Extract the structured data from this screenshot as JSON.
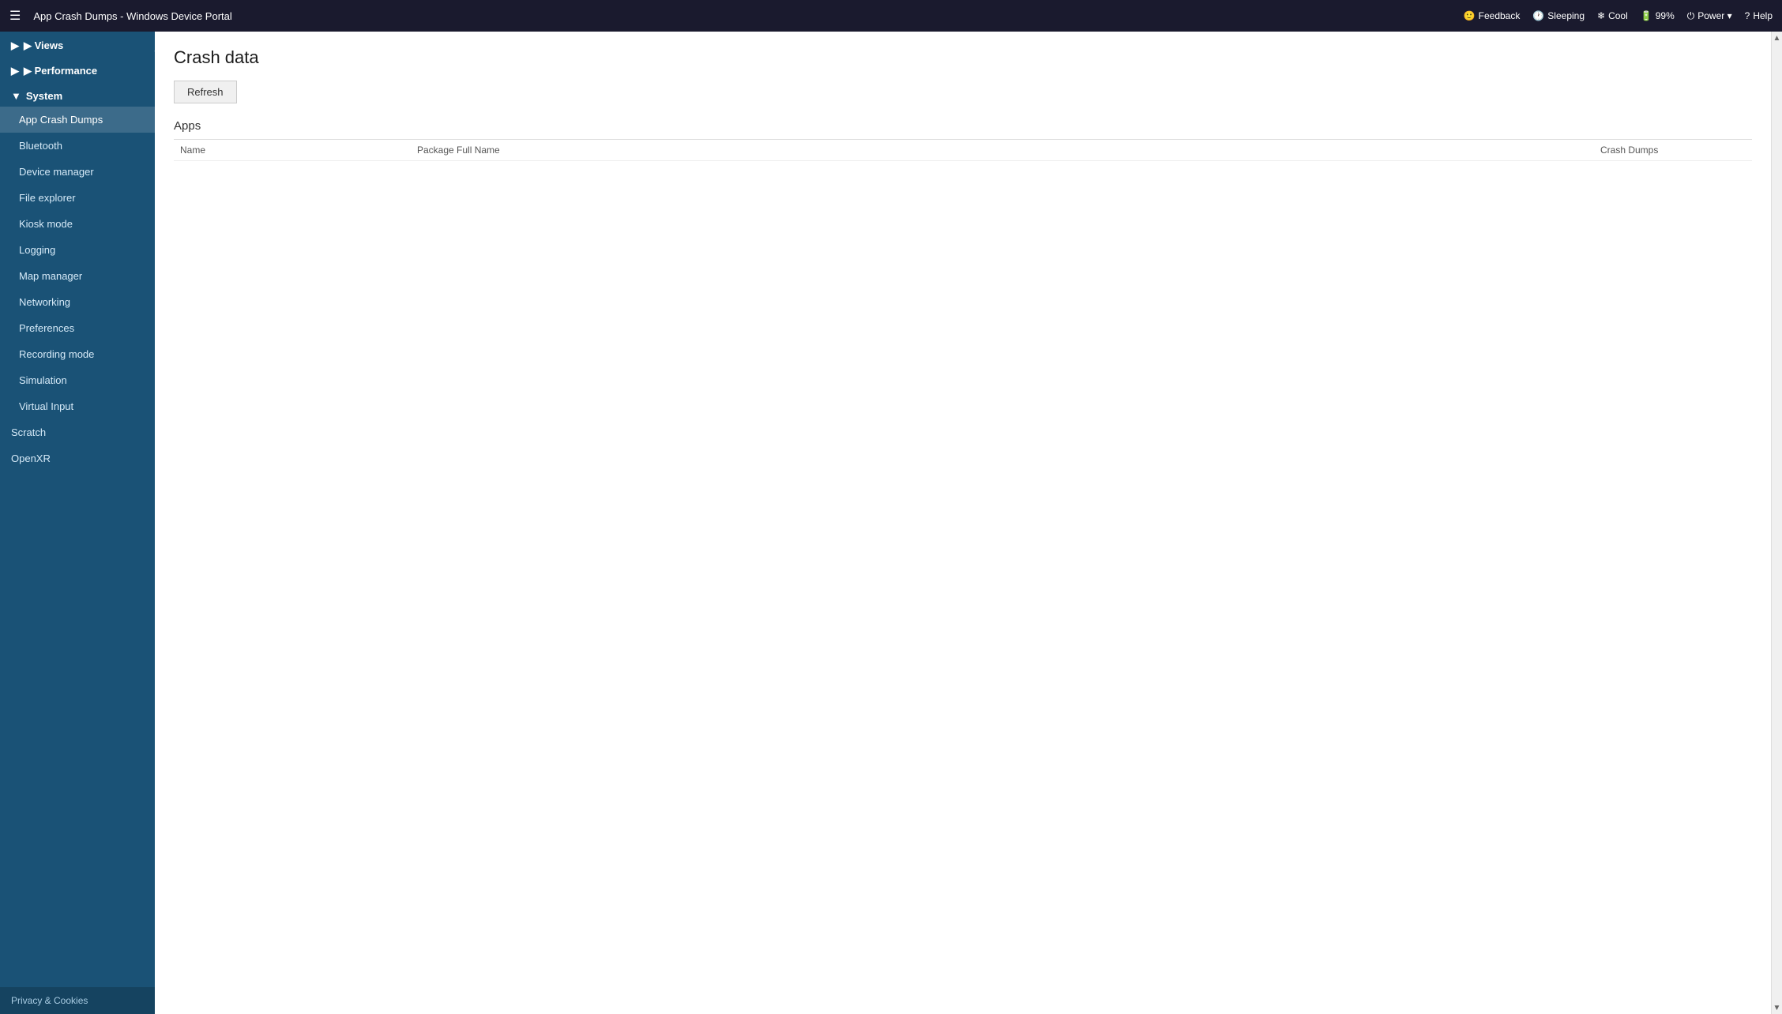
{
  "header": {
    "hamburger": "☰",
    "title": "App Crash Dumps - Windows Device Portal",
    "actions": [
      {
        "icon": "😊",
        "label": "Feedback",
        "key": "feedback"
      },
      {
        "icon": "🕐",
        "label": "Sleeping",
        "key": "sleeping"
      },
      {
        "icon": "❄",
        "label": "Cool",
        "key": "cool"
      },
      {
        "icon": "🔋",
        "label": "99%",
        "key": "battery"
      },
      {
        "icon": "⏻",
        "label": "Power ▾",
        "key": "power"
      },
      {
        "icon": "?",
        "label": "Help",
        "key": "help"
      }
    ]
  },
  "sidebar": {
    "collapse_icon": "◀",
    "sections": [
      {
        "label": "▶ Views",
        "key": "views",
        "expanded": false,
        "items": []
      },
      {
        "label": "▶ Performance",
        "key": "performance",
        "expanded": false,
        "items": []
      },
      {
        "label": "▼ System",
        "key": "system",
        "expanded": true,
        "items": [
          {
            "label": "App Crash Dumps",
            "key": "app-crash-dumps",
            "active": true
          },
          {
            "label": "Bluetooth",
            "key": "bluetooth",
            "active": false
          },
          {
            "label": "Device manager",
            "key": "device-manager",
            "active": false
          },
          {
            "label": "File explorer",
            "key": "file-explorer",
            "active": false
          },
          {
            "label": "Kiosk mode",
            "key": "kiosk-mode",
            "active": false
          },
          {
            "label": "Logging",
            "key": "logging",
            "active": false
          },
          {
            "label": "Map manager",
            "key": "map-manager",
            "active": false
          },
          {
            "label": "Networking",
            "key": "networking",
            "active": false
          },
          {
            "label": "Preferences",
            "key": "preferences",
            "active": false
          },
          {
            "label": "Recording mode",
            "key": "recording-mode",
            "active": false
          },
          {
            "label": "Simulation",
            "key": "simulation",
            "active": false
          },
          {
            "label": "Virtual Input",
            "key": "virtual-input",
            "active": false
          }
        ]
      }
    ],
    "top_items": [
      {
        "label": "Scratch",
        "key": "scratch"
      },
      {
        "label": "OpenXR",
        "key": "openxr"
      }
    ],
    "footer": "Privacy & Cookies"
  },
  "content": {
    "page_title": "Crash data",
    "refresh_button": "Refresh",
    "section_title": "Apps",
    "table_columns": [
      {
        "label": "Name",
        "key": "name"
      },
      {
        "label": "Package Full Name",
        "key": "package_full_name"
      },
      {
        "label": "Crash Dumps",
        "key": "crash_dumps"
      }
    ],
    "table_rows": []
  }
}
